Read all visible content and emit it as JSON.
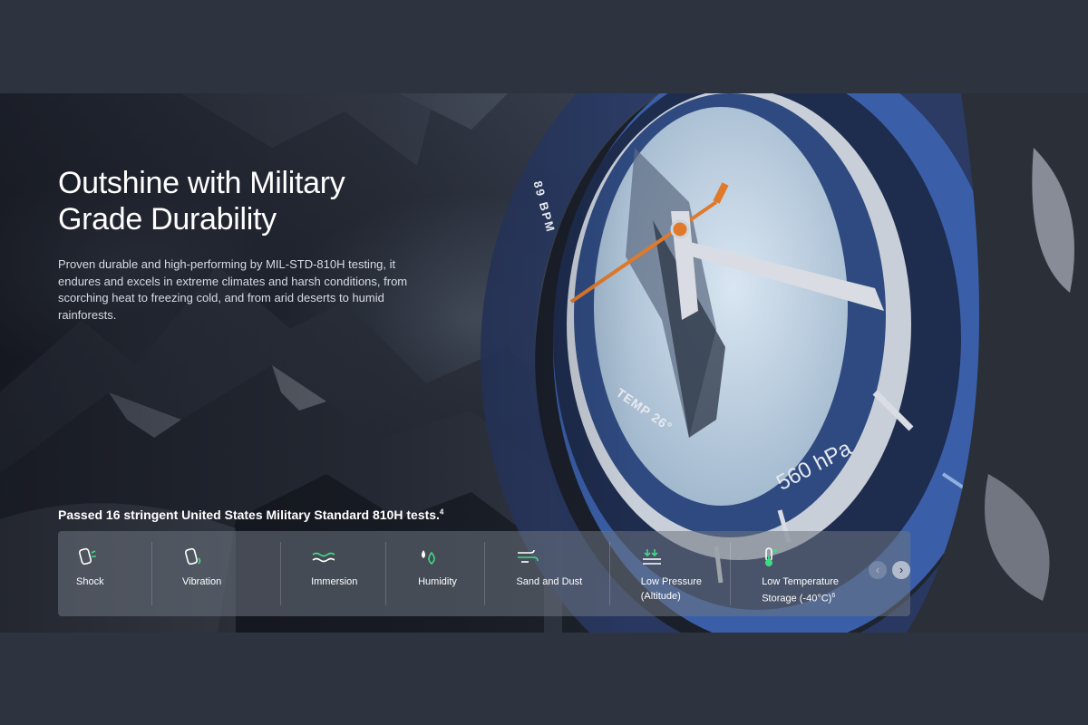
{
  "hero": {
    "title_line1": "Outshine with Military",
    "title_line2": "Grade Durability",
    "description": "Proven durable and high-performing by MIL-STD-810H testing, it endures and excels in extreme climates and harsh conditions, from scorching heat to freezing cold, and from arid deserts to humid rainforests.",
    "watch": {
      "bpm_text": "89 BPM",
      "temp_text": "TEMP 26°",
      "pressure_text": "560 hPa"
    }
  },
  "tests": {
    "heading": "Passed 16 stringent United States Military Standard 810H tests.",
    "heading_sup": "4",
    "items": [
      {
        "label": "Shock",
        "icon": "shock-icon"
      },
      {
        "label": "Vibration",
        "icon": "vibration-icon"
      },
      {
        "label": "Immersion",
        "icon": "immersion-icon"
      },
      {
        "label": "Humidity",
        "icon": "humidity-icon"
      },
      {
        "label": "Sand and Dust",
        "icon": "wind-icon"
      },
      {
        "label_line1": "Low Pressure",
        "label_line2": "(Altitude)",
        "icon": "pressure-icon"
      },
      {
        "label_line1": "Low Temperature",
        "label_line2": "Storage (-40°C)",
        "label_sup": "6",
        "icon": "thermometer-icon"
      }
    ],
    "prev_glyph": "‹",
    "next_glyph": "›"
  },
  "colors": {
    "page_bg": "#2e3340",
    "accent_green": "#3ddc84",
    "watch_blue": "#3a5fa8",
    "hand_orange": "#e07a2a"
  }
}
